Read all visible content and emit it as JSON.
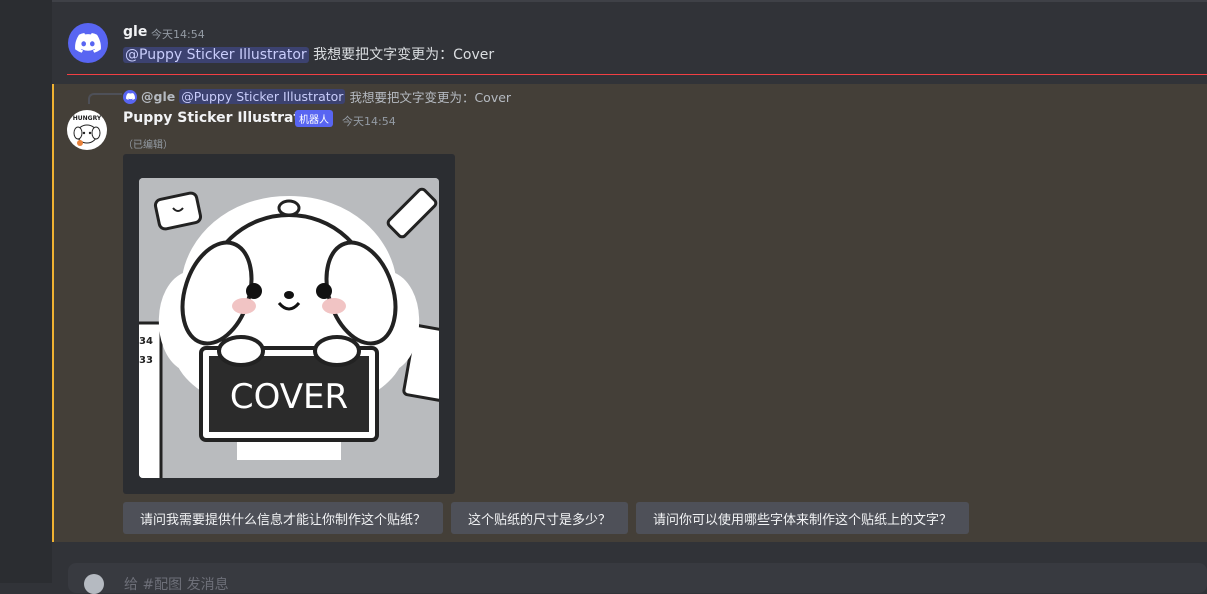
{
  "message1": {
    "author": "gle",
    "time": "今天14:54",
    "mention": "@Puppy Sticker Illustrator",
    "text": " 我想要把文字变更为：Cover"
  },
  "message2": {
    "reply": {
      "author": "@gle",
      "mention": "@Puppy Sticker Illustrator",
      "text": "我想要把文字变更为：Cover"
    },
    "author": "Puppy Sticker Illustrator",
    "badge": "机器人",
    "time": "今天14:54",
    "edited": "（已编辑）",
    "image": {
      "sign_text": "COVER",
      "avatar_text": "HUNGRY",
      "ruler_numbers": [
        "34",
        "33"
      ]
    },
    "suggestions": [
      "请问我需要提供什么信息才能让你制作这个贴纸？",
      "这个贴纸的尺寸是多少？",
      "请问你可以使用哪些字体来制作这个贴纸上的文字？"
    ]
  },
  "input": {
    "placeholder": "给 #配图 发消息"
  },
  "colors": {
    "blurple": "#5865f2",
    "highlight_bg": "#443f38",
    "highlight_bar": "#f0b232",
    "new_divider": "#f23f43"
  }
}
